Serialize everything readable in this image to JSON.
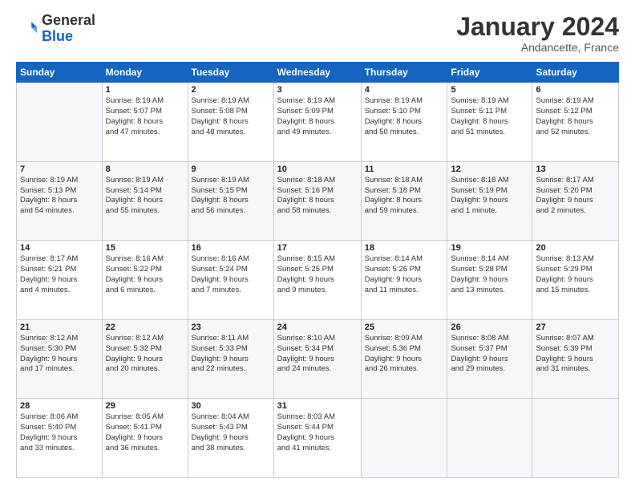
{
  "header": {
    "logo_general": "General",
    "logo_blue": "Blue",
    "month_title": "January 2024",
    "location": "Andancette, France"
  },
  "days_of_week": [
    "Sunday",
    "Monday",
    "Tuesday",
    "Wednesday",
    "Thursday",
    "Friday",
    "Saturday"
  ],
  "weeks": [
    [
      {
        "day": "",
        "info": ""
      },
      {
        "day": "1",
        "info": "Sunrise: 8:19 AM\nSunset: 5:07 PM\nDaylight: 8 hours\nand 47 minutes."
      },
      {
        "day": "2",
        "info": "Sunrise: 8:19 AM\nSunset: 5:08 PM\nDaylight: 8 hours\nand 48 minutes."
      },
      {
        "day": "3",
        "info": "Sunrise: 8:19 AM\nSunset: 5:09 PM\nDaylight: 8 hours\nand 49 minutes."
      },
      {
        "day": "4",
        "info": "Sunrise: 8:19 AM\nSunset: 5:10 PM\nDaylight: 8 hours\nand 50 minutes."
      },
      {
        "day": "5",
        "info": "Sunrise: 8:19 AM\nSunset: 5:11 PM\nDaylight: 8 hours\nand 51 minutes."
      },
      {
        "day": "6",
        "info": "Sunrise: 8:19 AM\nSunset: 5:12 PM\nDaylight: 8 hours\nand 52 minutes."
      }
    ],
    [
      {
        "day": "7",
        "info": "Sunrise: 8:19 AM\nSunset: 5:13 PM\nDaylight: 8 hours\nand 54 minutes."
      },
      {
        "day": "8",
        "info": "Sunrise: 8:19 AM\nSunset: 5:14 PM\nDaylight: 8 hours\nand 55 minutes."
      },
      {
        "day": "9",
        "info": "Sunrise: 8:19 AM\nSunset: 5:15 PM\nDaylight: 8 hours\nand 56 minutes."
      },
      {
        "day": "10",
        "info": "Sunrise: 8:18 AM\nSunset: 5:16 PM\nDaylight: 8 hours\nand 58 minutes."
      },
      {
        "day": "11",
        "info": "Sunrise: 8:18 AM\nSunset: 5:18 PM\nDaylight: 8 hours\nand 59 minutes."
      },
      {
        "day": "12",
        "info": "Sunrise: 8:18 AM\nSunset: 5:19 PM\nDaylight: 9 hours\nand 1 minute."
      },
      {
        "day": "13",
        "info": "Sunrise: 8:17 AM\nSunset: 5:20 PM\nDaylight: 9 hours\nand 2 minutes."
      }
    ],
    [
      {
        "day": "14",
        "info": "Sunrise: 8:17 AM\nSunset: 5:21 PM\nDaylight: 9 hours\nand 4 minutes."
      },
      {
        "day": "15",
        "info": "Sunrise: 8:16 AM\nSunset: 5:22 PM\nDaylight: 9 hours\nand 6 minutes."
      },
      {
        "day": "16",
        "info": "Sunrise: 8:16 AM\nSunset: 5:24 PM\nDaylight: 9 hours\nand 7 minutes."
      },
      {
        "day": "17",
        "info": "Sunrise: 8:15 AM\nSunset: 5:25 PM\nDaylight: 9 hours\nand 9 minutes."
      },
      {
        "day": "18",
        "info": "Sunrise: 8:14 AM\nSunset: 5:26 PM\nDaylight: 9 hours\nand 11 minutes."
      },
      {
        "day": "19",
        "info": "Sunrise: 8:14 AM\nSunset: 5:28 PM\nDaylight: 9 hours\nand 13 minutes."
      },
      {
        "day": "20",
        "info": "Sunrise: 8:13 AM\nSunset: 5:29 PM\nDaylight: 9 hours\nand 15 minutes."
      }
    ],
    [
      {
        "day": "21",
        "info": "Sunrise: 8:12 AM\nSunset: 5:30 PM\nDaylight: 9 hours\nand 17 minutes."
      },
      {
        "day": "22",
        "info": "Sunrise: 8:12 AM\nSunset: 5:32 PM\nDaylight: 9 hours\nand 20 minutes."
      },
      {
        "day": "23",
        "info": "Sunrise: 8:11 AM\nSunset: 5:33 PM\nDaylight: 9 hours\nand 22 minutes."
      },
      {
        "day": "24",
        "info": "Sunrise: 8:10 AM\nSunset: 5:34 PM\nDaylight: 9 hours\nand 24 minutes."
      },
      {
        "day": "25",
        "info": "Sunrise: 8:09 AM\nSunset: 5:36 PM\nDaylight: 9 hours\nand 26 minutes."
      },
      {
        "day": "26",
        "info": "Sunrise: 8:08 AM\nSunset: 5:37 PM\nDaylight: 9 hours\nand 29 minutes."
      },
      {
        "day": "27",
        "info": "Sunrise: 8:07 AM\nSunset: 5:39 PM\nDaylight: 9 hours\nand 31 minutes."
      }
    ],
    [
      {
        "day": "28",
        "info": "Sunrise: 8:06 AM\nSunset: 5:40 PM\nDaylight: 9 hours\nand 33 minutes."
      },
      {
        "day": "29",
        "info": "Sunrise: 8:05 AM\nSunset: 5:41 PM\nDaylight: 9 hours\nand 36 minutes."
      },
      {
        "day": "30",
        "info": "Sunrise: 8:04 AM\nSunset: 5:43 PM\nDaylight: 9 hours\nand 38 minutes."
      },
      {
        "day": "31",
        "info": "Sunrise: 8:03 AM\nSunset: 5:44 PM\nDaylight: 9 hours\nand 41 minutes."
      },
      {
        "day": "",
        "info": ""
      },
      {
        "day": "",
        "info": ""
      },
      {
        "day": "",
        "info": ""
      }
    ]
  ]
}
